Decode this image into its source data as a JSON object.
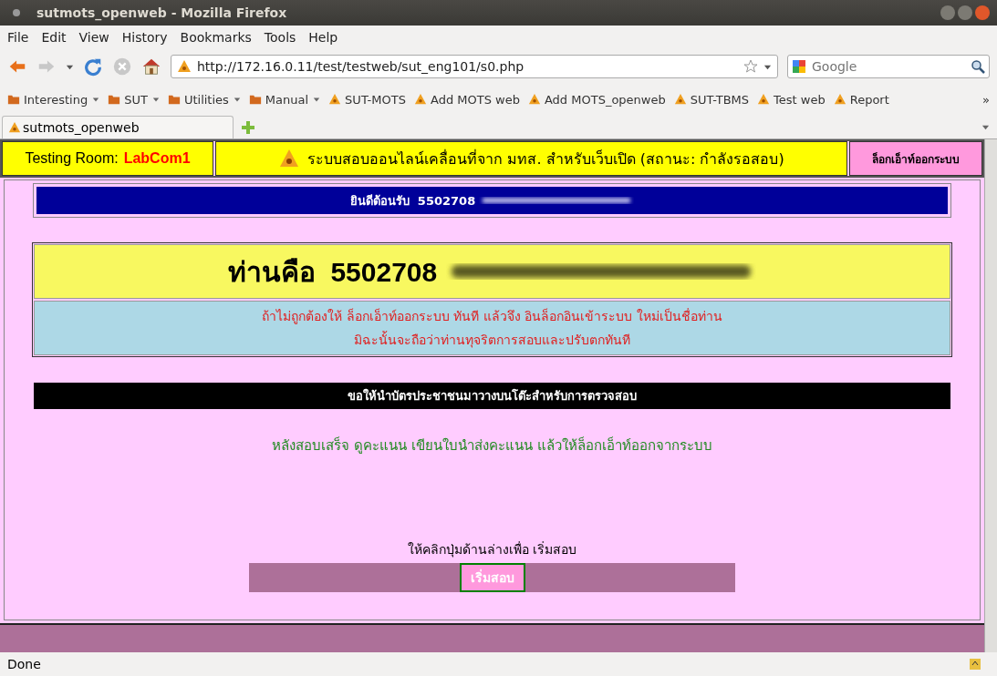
{
  "window": {
    "title": "sutmots_openweb - Mozilla Firefox"
  },
  "menu": [
    "File",
    "Edit",
    "View",
    "History",
    "Bookmarks",
    "Tools",
    "Help"
  ],
  "address": {
    "value": "http://172.16.0.11/test/testweb/sut_eng101/s0.php"
  },
  "search": {
    "placeholder": "Google"
  },
  "bookmarks": [
    {
      "label": "Interesting",
      "kind": "folder"
    },
    {
      "label": "SUT",
      "kind": "folder"
    },
    {
      "label": "Utilities",
      "kind": "folder"
    },
    {
      "label": "Manual",
      "kind": "folder"
    },
    {
      "label": "SUT-MOTS",
      "kind": "link"
    },
    {
      "label": "Add MOTS web",
      "kind": "link"
    },
    {
      "label": "Add MOTS_openweb",
      "kind": "link"
    },
    {
      "label": "SUT-TBMS",
      "kind": "link"
    },
    {
      "label": "Test web",
      "kind": "link"
    },
    {
      "label": "Report",
      "kind": "link"
    }
  ],
  "more_bookmarks": "»",
  "tabs": [
    {
      "label": "sutmots_openweb",
      "selected": true
    }
  ],
  "header": {
    "room_label": "Testing  Room:",
    "room": "LabCom1",
    "system_title": "ระบบสอบออนไลน์เคลื่อนที่จาก มทส. สำหรับเว็บเปิด (สถานะ: กำลังรอสอบ)",
    "logout": "ล็อกเอ็าท์ออกระบบ"
  },
  "welcome": {
    "label": "ยินดีต้อนรับ",
    "id": "5502708"
  },
  "identity": {
    "label": "ท่านคือ",
    "id": "5502708"
  },
  "warning": [
    "ถ้าไม่ถูกต้องให้  ล็อกเอ็าท์ออกระบบ  ทันที  แล้วจึง  อินล็อกอินเข้าระบบ  ใหม่เป็นชื่อท่าน",
    "มิฉะนั้นจะถือว่าท่านทุจริตการสอบและปรับตกทันที"
  ],
  "id_card_notice": "ขอให้นำบัตรประชาชนมาวางบนโต๊ะสำหรับการตรวจสอบ",
  "after_exam": "หลังสอบเสร็จ  ดูคะแนน  เขียนใบนำส่งคะแนน  แล้วให้ล็อกเอ็าท์ออกจากระบบ",
  "start_prompt": "ให้คลิกปุ่มด้านล่างเพื่อ  เริ่มสอบ",
  "start_button": "เริ่มสอบ",
  "status_bar": "Done"
}
